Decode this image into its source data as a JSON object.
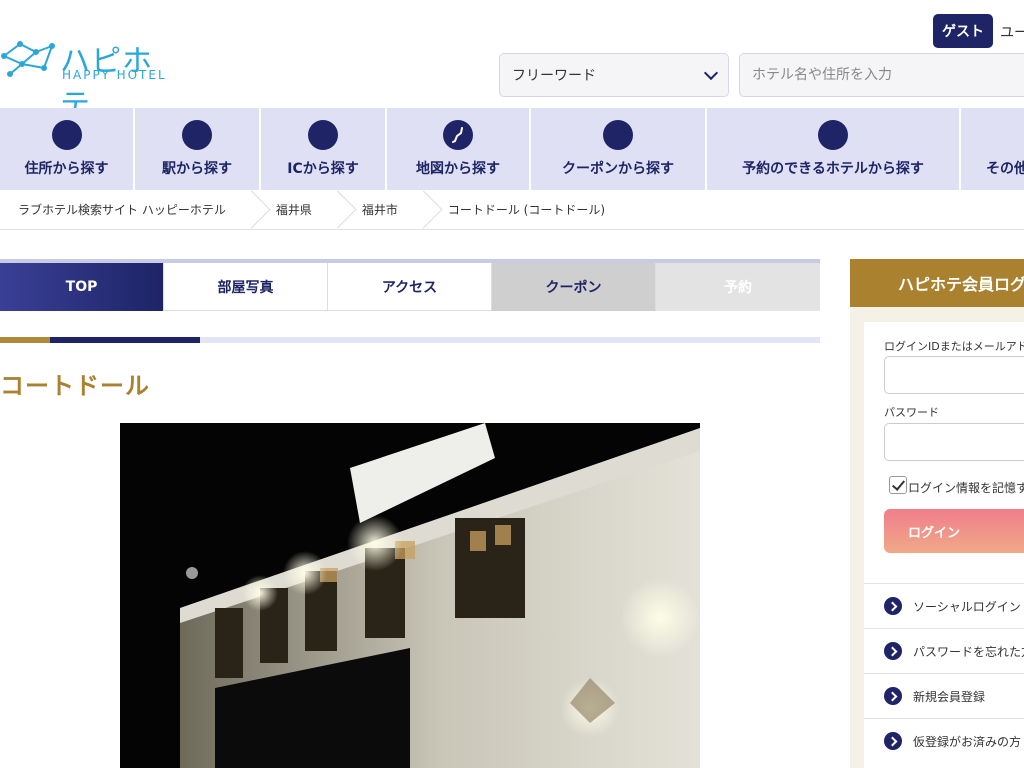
{
  "header": {
    "logo_jp": "ハピホテ",
    "logo_en": "HAPPY HOTEL",
    "guest_label": "ゲスト",
    "user_label": "ユー",
    "search_mode": "フリーワード",
    "search_placeholder": "ホテル名や住所を入力"
  },
  "nav": {
    "items": [
      {
        "label": "住所から探す"
      },
      {
        "label": "駅から探す"
      },
      {
        "label": "ICから探す"
      },
      {
        "label": "地図から探す"
      },
      {
        "label": "クーポンから探す"
      },
      {
        "label": "予約のできるホテルから探す"
      },
      {
        "label": "その他"
      }
    ]
  },
  "breadcrumb": [
    "ラブホテル検索サイト ハッピーホテル",
    "福井県",
    "福井市",
    "コートドール (コートドール)"
  ],
  "tabs": [
    "TOP",
    "部屋写真",
    "アクセス",
    "クーポン",
    "予約"
  ],
  "hotel": {
    "name": "コートドール"
  },
  "login": {
    "title": "ハピホテ会員ログ",
    "id_label": "ログインIDまたはメールアドレ",
    "password_label": "パスワード",
    "remember_label": "ログイン情報を記憶す",
    "button_label": "ログイン",
    "links": [
      {
        "label": "ソーシャルログイン"
      },
      {
        "label": "パスワードを忘れた方"
      },
      {
        "label": "新規会員登録"
      },
      {
        "label": "仮登録がお済みの方"
      }
    ]
  }
}
